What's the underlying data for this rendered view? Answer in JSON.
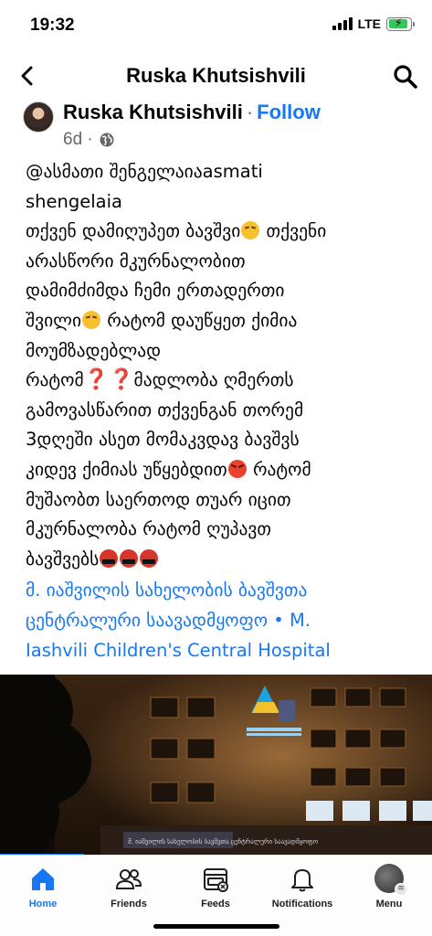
{
  "status_bar": {
    "time": "19:32",
    "network": "LTE",
    "battery_level": 0.9
  },
  "header": {
    "title": "Ruska Khutsishvili"
  },
  "post": {
    "author": "Ruska Khutsishvili",
    "separator": "·",
    "follow_label": "Follow",
    "time_ago": "6d ·",
    "audience_icon": "globe-icon",
    "lines": [
      "@ასმათი შენგელაიაasmati",
      "shengelaia",
      "თქვენ დამიღუპეთ ბავშვი",
      "თქვენი",
      "არასწორი მკურნალობით",
      "დამიმძიმდა ჩემი ერთადერთი",
      "შვილი",
      "რატომ დაუწყეთ ქიმია",
      "მოუმზადებლად",
      "რატომ",
      "მადლობა ღმერთს",
      "გამოვასწარით თქვენგან თორემ",
      "3დღეში ასეთ მომაკვდავ ბავშვს",
      "კიდევ ქიმიას უწყებდით",
      "რატომ",
      "მუშაობთ საერთოდ თუარ იცით",
      "მკურნალობა რატომ ღუპავთ",
      "ბავშვებს"
    ],
    "qmarks": "❓❓",
    "link_text": {
      "line1": "მ. იაშვილის სახელობის ბავშვთა",
      "line2": "ცენტრალური საავადმყოფო • M.",
      "line3": "Iashvili Children's Central Hospital"
    }
  },
  "photo": {
    "sign_text": "მ. იაშვილის სახელობის ბავშვთა ცენტრალური საავადმყოფო"
  },
  "bottom_nav": {
    "items": [
      {
        "label": "Home",
        "icon": "home-icon",
        "active": true
      },
      {
        "label": "Friends",
        "icon": "friends-icon",
        "active": false
      },
      {
        "label": "Feeds",
        "icon": "feeds-icon",
        "active": false
      },
      {
        "label": "Notifications",
        "icon": "bell-icon",
        "active": false
      },
      {
        "label": "Menu",
        "icon": "profile-avatar",
        "active": false
      }
    ],
    "active_color": "#1877f2"
  },
  "colors": {
    "link": "#1877f2",
    "text": "#050505",
    "muted": "#65676b"
  }
}
